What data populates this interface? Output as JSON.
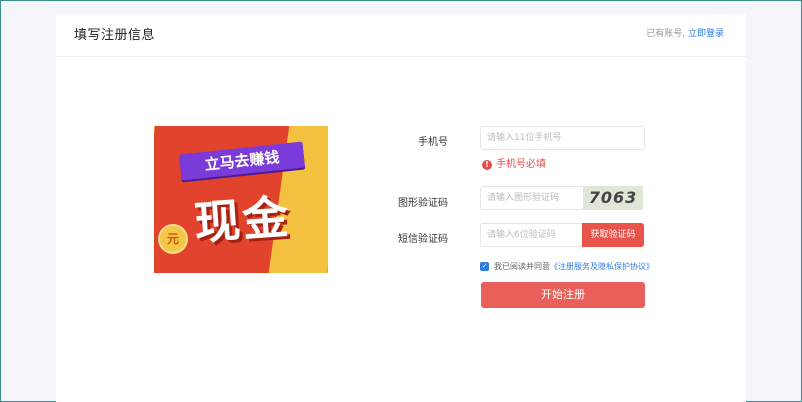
{
  "header": {
    "title": "填写注册信息",
    "have_account": "已有账号,",
    "login_link": "立即登录"
  },
  "banner": {
    "ribbon_text": "立马去赚钱",
    "big_text": "现金",
    "coin_text": "元"
  },
  "form": {
    "phone": {
      "label": "手机号",
      "placeholder": "请输入11位手机号",
      "error": "手机号必填"
    },
    "captcha": {
      "label": "图形验证码",
      "placeholder": "请输入图形验证码",
      "image_text": "7063"
    },
    "sms": {
      "label": "短信验证码",
      "placeholder": "请输入6位验证码",
      "button": "获取验证码"
    },
    "agreement": {
      "checked": true,
      "text": "我已阅读并同意",
      "link": "《注册服务及隐私保护协议》"
    },
    "submit": "开始注册"
  },
  "colors": {
    "accent_red": "#e9605a",
    "link_blue": "#2d7be5",
    "error_red": "#e84b4b"
  }
}
